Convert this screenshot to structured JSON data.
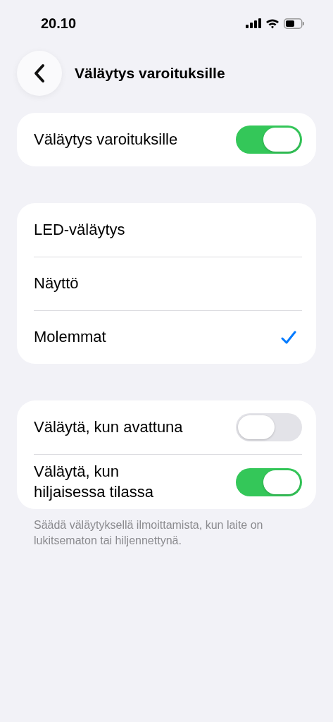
{
  "status_bar": {
    "time": "20.10"
  },
  "nav": {
    "title": "Väläytys varoituksille"
  },
  "groups": [
    {
      "rows": [
        {
          "kind": "toggle",
          "label": "Väläytys varoituksille",
          "on": true
        }
      ]
    },
    {
      "rows": [
        {
          "kind": "option",
          "label": "LED-väläytys",
          "selected": false
        },
        {
          "kind": "option",
          "label": "Näyttö",
          "selected": false
        },
        {
          "kind": "option",
          "label": "Molemmat",
          "selected": true
        }
      ]
    },
    {
      "rows": [
        {
          "kind": "toggle",
          "label": "Väläytä, kun avattuna",
          "on": false
        },
        {
          "kind": "toggle",
          "label": "Väläytä, kun hiljaisessa tilassa",
          "on": true
        }
      ],
      "footer": "Säädä väläytyksellä ilmoittamista, kun laite on lukitsematon tai hiljennettynä."
    }
  ]
}
